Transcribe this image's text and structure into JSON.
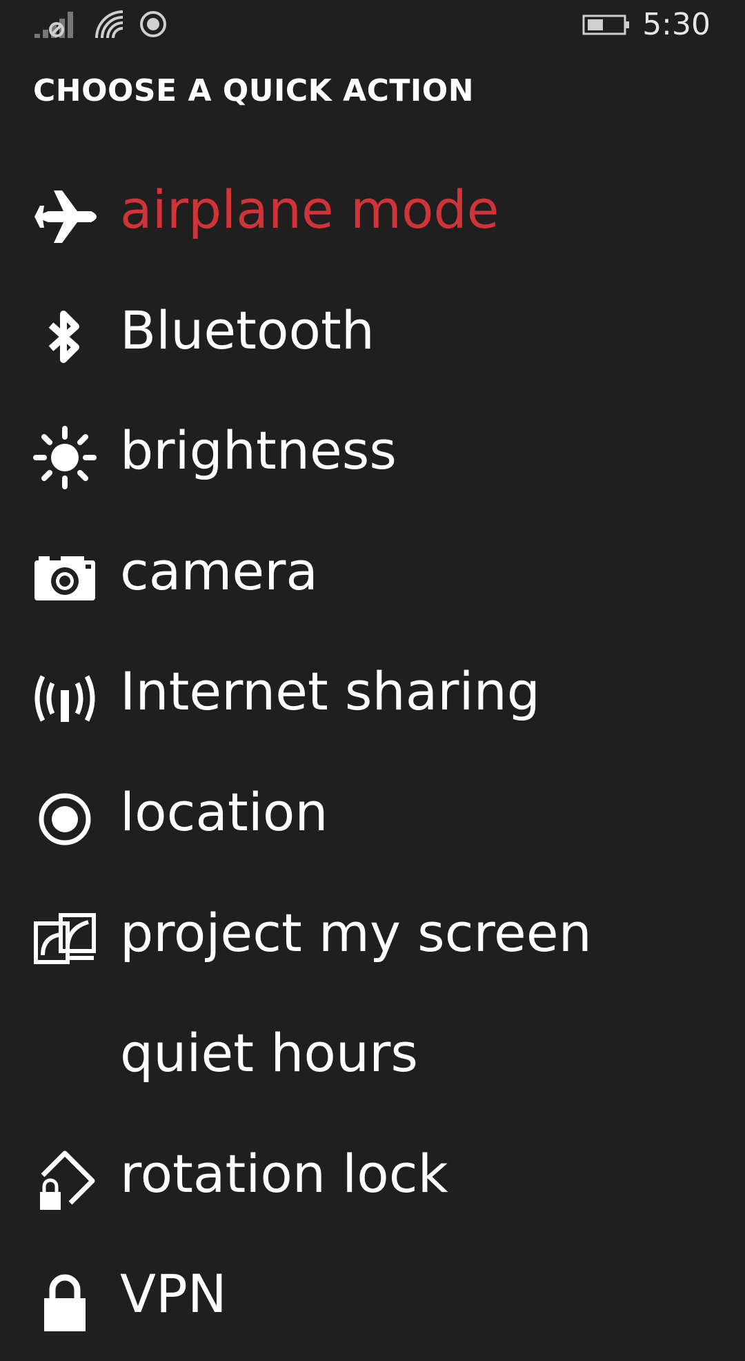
{
  "status_bar": {
    "time": "5:30",
    "icons": [
      "signal-off-icon",
      "wifi-icon",
      "location-status-icon",
      "battery-icon"
    ]
  },
  "page": {
    "title": "CHOOSE A QUICK ACTION"
  },
  "colors": {
    "background": "#1f1f1f",
    "accent": "#d13438",
    "text": "#ffffff"
  },
  "actions": [
    {
      "label": "airplane mode",
      "icon": "airplane-icon",
      "selected": true
    },
    {
      "label": "Bluetooth",
      "icon": "bluetooth-icon",
      "selected": false
    },
    {
      "label": "brightness",
      "icon": "brightness-icon",
      "selected": false
    },
    {
      "label": "camera",
      "icon": "camera-icon",
      "selected": false
    },
    {
      "label": "Internet sharing",
      "icon": "internet-sharing-icon",
      "selected": false
    },
    {
      "label": "location",
      "icon": "location-icon",
      "selected": false
    },
    {
      "label": "project my screen",
      "icon": "project-screen-icon",
      "selected": false
    },
    {
      "label": "quiet hours",
      "icon": "moon-icon",
      "selected": false
    },
    {
      "label": "rotation lock",
      "icon": "rotation-lock-icon",
      "selected": false
    },
    {
      "label": "VPN",
      "icon": "lock-icon",
      "selected": false
    }
  ]
}
